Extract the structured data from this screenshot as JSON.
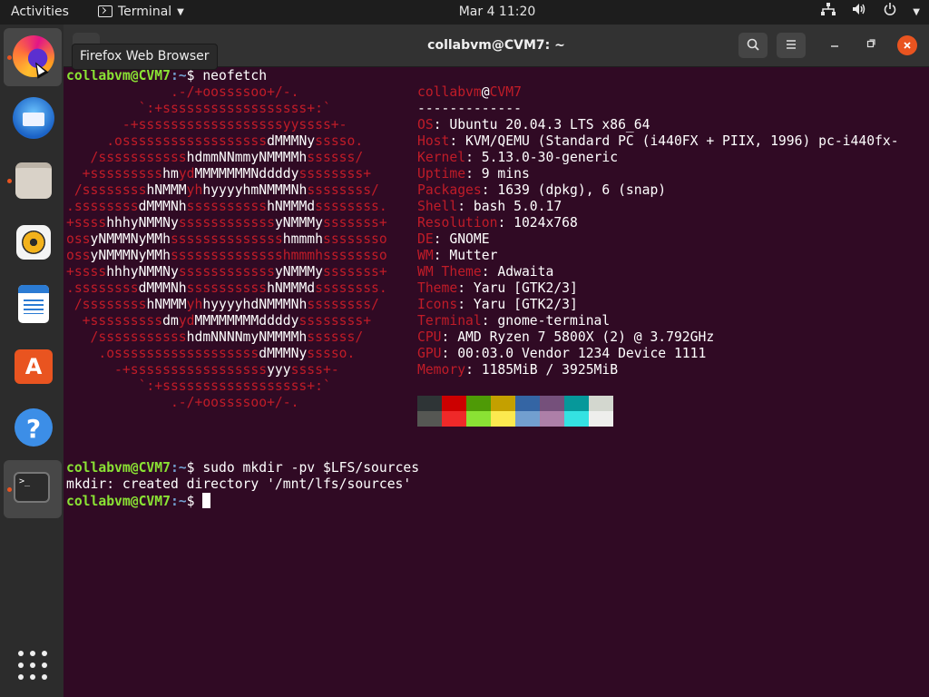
{
  "topbar": {
    "activities": "Activities",
    "app_menu": "Terminal",
    "clock": "Mar 4  11:20"
  },
  "dock": {
    "items": [
      {
        "name": "Firefox Web Browser",
        "icon": "firefox-icon",
        "running": true
      },
      {
        "name": "Thunderbird Mail",
        "icon": "thunderbird-icon",
        "running": false
      },
      {
        "name": "Files",
        "icon": "files-icon",
        "running": true
      },
      {
        "name": "Rhythmbox",
        "icon": "rhythmbox-icon",
        "running": false
      },
      {
        "name": "LibreOffice Writer",
        "icon": "writer-icon",
        "running": false
      },
      {
        "name": "Ubuntu Software",
        "icon": "software-icon",
        "running": false
      },
      {
        "name": "Help",
        "icon": "help-icon",
        "running": false
      },
      {
        "name": "Terminal",
        "icon": "terminal-icon",
        "running": true
      }
    ],
    "tooltip": "Firefox Web Browser",
    "software_glyph": "A",
    "help_glyph": "?",
    "terminal_glyph": ">_"
  },
  "window": {
    "title": "collabvm@CVM7: ~"
  },
  "terminal": {
    "user": "collabvm@CVM7",
    "path": ":~",
    "prompt_symbol": "$",
    "cmd1": " neofetch",
    "cmd2": " sudo mkdir -pv $LFS/sources",
    "output2": "mkdir: created directory '/mnt/lfs/sources'",
    "ascii_lines": [
      "             .-/+oossssoo+/-.",
      "         `:+ssssssssssssssssss+:`",
      "       -+ssssssssssssssssssyyssss+-",
      "     .ossssssssssssssssss@dMMMNy@sssso.",
      "   /sssssssssss@hdmmNNmmyNMMMMh@ssssss/",
      "  +sssssssss@hm@yd@MMMMMMMNddddy@ssssssss+",
      " /ssssssss@hNMMM@yh@hyyyyhmNMMMNh@ssssssss/",
      ".ssssssss@dMMMNh@ssssssssss@hNMMMd@ssssssss.",
      "+ssss@hhhyNMMNy@ssssssssssss@yNMMMy@sssssss+",
      "oss@yNMMMNyMMh@ssssssssssssss@hmmmh@ssssssso",
      "oss@yNMMMNyMMh@sssssssssssssshmmmhssssssso",
      "+ssss@hhhyNMMNy@ssssssssssss@yNMMMy@sssssss+",
      ".ssssssss@dMMMNh@ssssssssss@hNMMMd@ssssssss.",
      " /ssssssss@hNMMM@yh@hyyyyhdNMMMNh@ssssssss/",
      "  +sssssssss@dm@yd@MMMMMMMMddddy@ssssssss+",
      "   /sssssssssss@hdmNNNNmyNMMMMh@ssssss/",
      "    .ossssssssssssssssss@dMMMNy@sssso.",
      "      -+sssssssssssssssss@yyy@ssss+-",
      "         `:+ssssssssssssssssss+:`",
      "             .-/+oossssoo+/-."
    ],
    "info_header_user": "collabvm",
    "info_header_at": "@",
    "info_header_host": "CVM7",
    "info_separator": "-------------",
    "info": [
      {
        "label": "OS",
        "value": ": Ubuntu 20.04.3 LTS x86_64"
      },
      {
        "label": "Host",
        "value": ": KVM/QEMU (Standard PC (i440FX + PIIX, 1996) pc-i440fx-"
      },
      {
        "label": "Kernel",
        "value": ": 5.13.0-30-generic"
      },
      {
        "label": "Uptime",
        "value": ": 9 mins"
      },
      {
        "label": "Packages",
        "value": ": 1639 (dpkg), 6 (snap)"
      },
      {
        "label": "Shell",
        "value": ": bash 5.0.17"
      },
      {
        "label": "Resolution",
        "value": ": 1024x768"
      },
      {
        "label": "DE",
        "value": ": GNOME"
      },
      {
        "label": "WM",
        "value": ": Mutter"
      },
      {
        "label": "WM Theme",
        "value": ": Adwaita"
      },
      {
        "label": "Theme",
        "value": ": Yaru [GTK2/3]"
      },
      {
        "label": "Icons",
        "value": ": Yaru [GTK2/3]"
      },
      {
        "label": "Terminal",
        "value": ": gnome-terminal"
      },
      {
        "label": "CPU",
        "value": ": AMD Ryzen 7 5800X (2) @ 3.792GHz"
      },
      {
        "label": "GPU",
        "value": ": 00:03.0 Vendor 1234 Device 1111"
      },
      {
        "label": "Memory",
        "value": ": 1185MiB / 3925MiB"
      }
    ],
    "palette_top": [
      "#2e3436",
      "#cc0000",
      "#4e9a06",
      "#c4a000",
      "#3465a4",
      "#75507b",
      "#06989a",
      "#d3d7cf"
    ],
    "palette_bottom": [
      "#555753",
      "#ef2929",
      "#8ae234",
      "#fce94f",
      "#729fcf",
      "#ad7fa8",
      "#34e2e2",
      "#eeeeec"
    ]
  },
  "colors": {
    "terminal_bg": "#300a24",
    "accent": "#e95420",
    "prompt_user": "#8ae234",
    "prompt_path": "#729fcf",
    "ascii_red": "#c01c28"
  }
}
